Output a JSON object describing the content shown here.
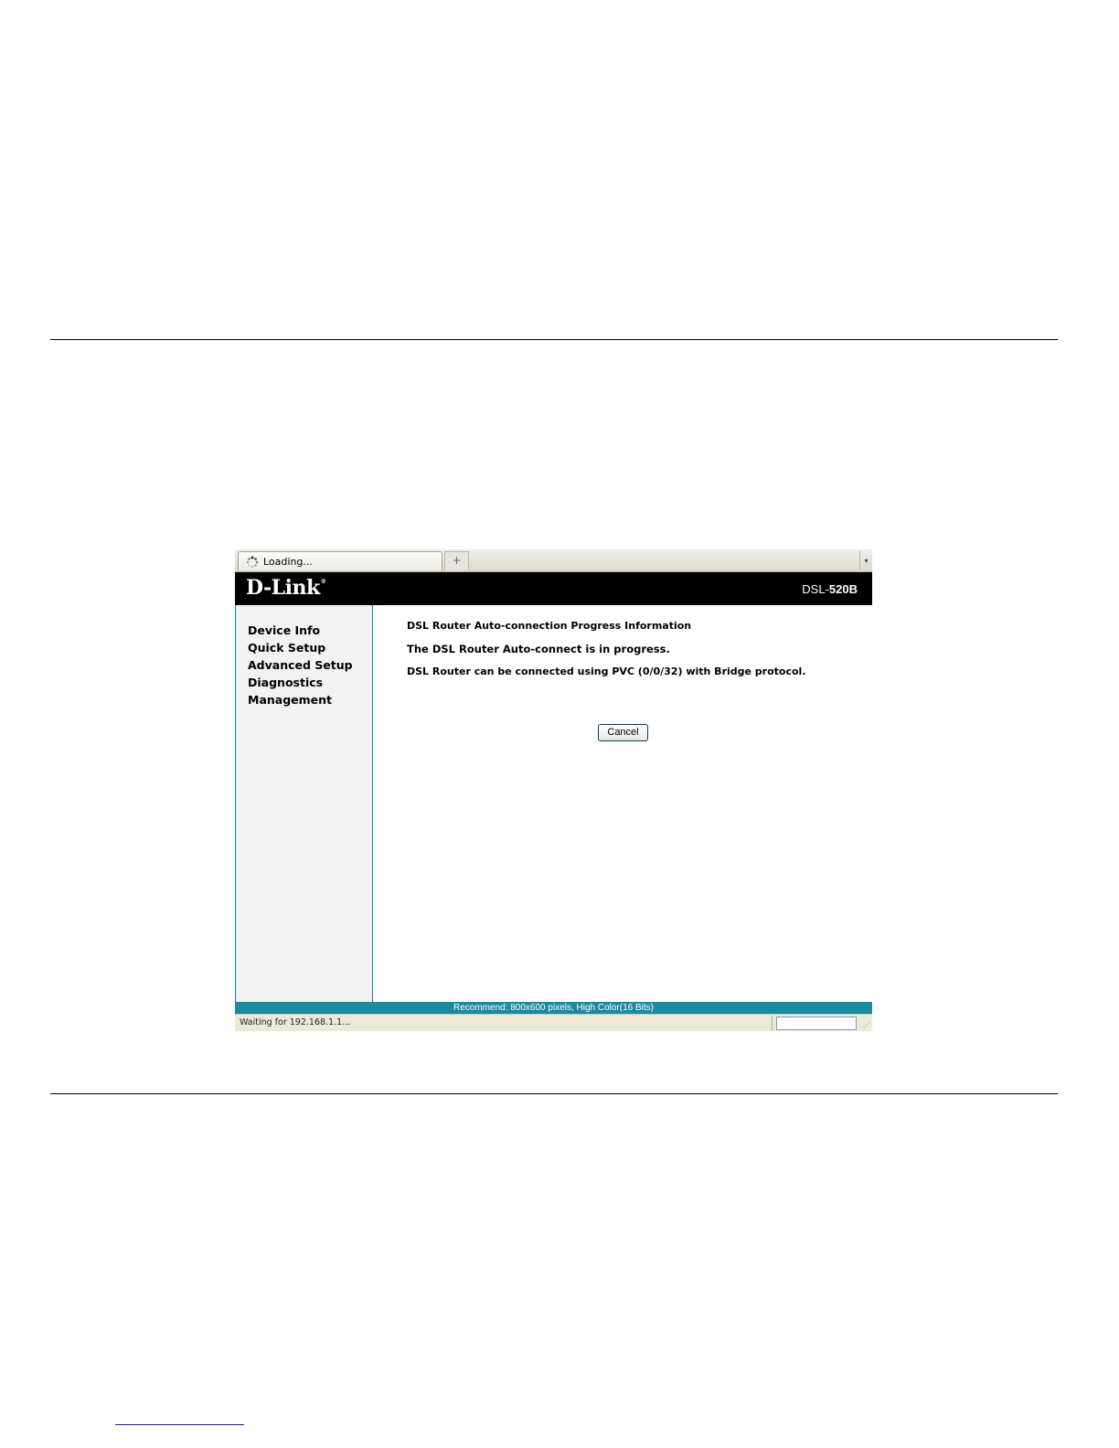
{
  "browser": {
    "tab": {
      "label": "Loading...",
      "icon": "loading-spinner-icon"
    },
    "new_tab_symbol": "+",
    "tab_list_symbol": "▾"
  },
  "router": {
    "brand": "D-Link",
    "brand_mark": "®",
    "model_prefix": "DSL-",
    "model_number": "520B"
  },
  "sidebar": {
    "items": [
      {
        "label": "Device Info"
      },
      {
        "label": "Quick Setup"
      },
      {
        "label": "Advanced Setup"
      },
      {
        "label": "Diagnostics"
      },
      {
        "label": "Management"
      }
    ]
  },
  "main": {
    "title": "DSL Router Auto-connection Progress Information",
    "line1": "The DSL Router Auto-connect is in progress.",
    "line2": "DSL Router can be connected using PVC (0/0/32) with Bridge protocol.",
    "cancel_label": "Cancel"
  },
  "footer": {
    "recommend": "Recommend: 800x600 pixels, High Color(16 Bits)"
  },
  "statusbar": {
    "text": "Waiting for 192.168.1.1..."
  },
  "colors": {
    "header_bg": "#000000",
    "accent_teal": "#1a8aa0",
    "sidebar_bg": "#f2f2f2"
  }
}
